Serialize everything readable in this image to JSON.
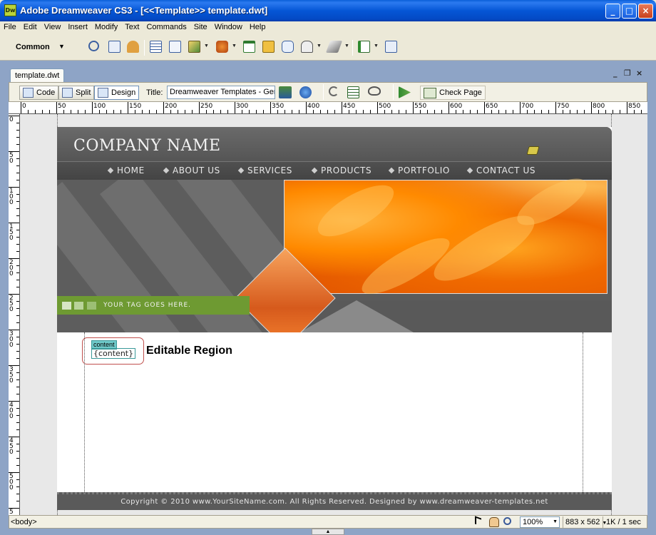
{
  "window": {
    "app_icon": "Dw",
    "title": "Adobe Dreamweaver CS3 - [<<Template>> template.dwt]",
    "controls": {
      "minimize": "_",
      "maximize": "□",
      "close": "×"
    }
  },
  "menubar": {
    "items": [
      "File",
      "Edit",
      "View",
      "Insert",
      "Modify",
      "Text",
      "Commands",
      "Site",
      "Window",
      "Help"
    ]
  },
  "insertbar": {
    "category": "Common",
    "category_arrow": "▼",
    "icons": [
      "hyperlink-icon",
      "email-link-icon",
      "named-anchor-icon",
      "table-icon",
      "insert-div-icon",
      "images-icon",
      "media-icon",
      "date-icon",
      "server-side-include-icon",
      "comment-icon",
      "head-icon",
      "script-icon",
      "templates-icon",
      "tag-chooser-icon"
    ]
  },
  "document": {
    "tab_label": "template.dwt",
    "tab_controls": {
      "minimize": "_",
      "restore": "❐",
      "close": "×"
    },
    "toolbar": {
      "code_label": "Code",
      "split_label": "Split",
      "design_label": "Design",
      "title_label": "Title:",
      "title_value": "Dreamweaver Templates - Ger",
      "check_page_label": "Check Page"
    },
    "ruler": {
      "top_labels": [
        "0",
        "50",
        "100",
        "150",
        "200",
        "250",
        "300",
        "350",
        "400",
        "450",
        "500",
        "550",
        "600",
        "650",
        "700",
        "750",
        "800",
        "850"
      ],
      "left_labels": [
        "0",
        "5 0",
        "1 0 0",
        "1 5 0",
        "2 0 0",
        "2 5 0",
        "3 0 0",
        "3 5 0",
        "4 0 0",
        "4 5 0",
        "5 0 0",
        "5"
      ]
    }
  },
  "page": {
    "company_name": "COMPANY NAME",
    "nav": [
      "HOME",
      "ABOUT US",
      "SERVICES",
      "PRODUCTS",
      "PORTFOLIO",
      "CONTACT US"
    ],
    "tagline": "YOUR TAG GOES HERE.",
    "editable_region": {
      "tag_label": "content",
      "placeholder": "{content}",
      "caption": "Editable Region"
    },
    "footer": "Copyright © 2010 www.YourSiteName.com. All Rights Reserved. Designed by www.dreamweaver-templates.net"
  },
  "statusbar": {
    "tag_selector": "<body>",
    "zoom": "100%",
    "zoom_arrow": "▼",
    "dimensions": "883 x 562",
    "dimensions_arrow": "▼",
    "download": "1K / 1 sec"
  },
  "colors": {
    "title_bar": "#0556d6",
    "header_gray": "#5b5b5b",
    "tag_green": "#6e9a32",
    "flower_orange": "#ff8a00",
    "editable_border": "#c0504d"
  }
}
